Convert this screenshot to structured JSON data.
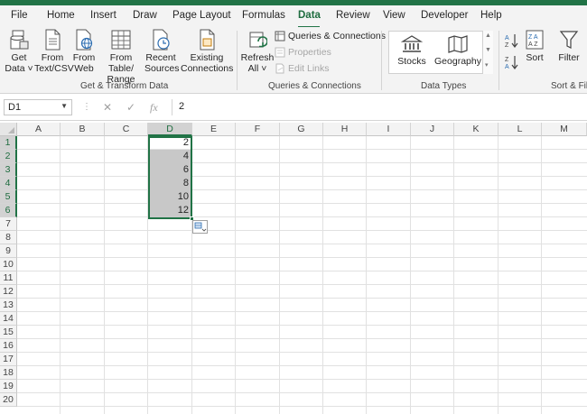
{
  "menu": {
    "tabs": [
      "File",
      "Home",
      "Insert",
      "Draw",
      "Page Layout",
      "Formulas",
      "Data",
      "Review",
      "View",
      "Developer",
      "Help"
    ],
    "active_tab": "Data"
  },
  "ribbon": {
    "get_data": {
      "line1": "Get",
      "line2": "Data ˅"
    },
    "from_text_csv": {
      "line1": "From",
      "line2": "Text/CSV"
    },
    "from_web": {
      "line1": "From",
      "line2": "Web"
    },
    "from_table_range": {
      "line1": "From Table/",
      "line2": "Range"
    },
    "recent_sources": {
      "line1": "Recent",
      "line2": "Sources"
    },
    "existing_connections": {
      "line1": "Existing",
      "line2": "Connections"
    },
    "refresh_all": {
      "line1": "Refresh",
      "line2": "All ˅"
    },
    "queries_connections": "Queries & Connections",
    "properties": "Properties",
    "edit_links": "Edit Links",
    "stocks": "Stocks",
    "geography": "Geography",
    "sort": "Sort",
    "filter": "Filter",
    "groups": {
      "get_transform": "Get & Transform Data",
      "queries": "Queries & Connections",
      "data_types": "Data Types",
      "sort_filter": "Sort & Filt"
    }
  },
  "formula_bar": {
    "name_box": "D1",
    "fx_symbol": "fx",
    "cancel_symbol": "✕",
    "enter_symbol": "✓",
    "value": "2"
  },
  "grid": {
    "columns": [
      "A",
      "B",
      "C",
      "D",
      "E",
      "F",
      "G",
      "H",
      "I",
      "J",
      "K",
      "L",
      "M"
    ],
    "rows": [
      "1",
      "2",
      "3",
      "4",
      "5",
      "6",
      "7",
      "8",
      "9",
      "10",
      "11",
      "12",
      "13",
      "14",
      "15",
      "16",
      "17",
      "18",
      "19",
      "20"
    ],
    "selected_column": "D",
    "column_d_values": [
      "2",
      "4",
      "6",
      "8",
      "10",
      "12"
    ]
  },
  "colors": {
    "accent": "#217346",
    "selection_fill": "#c8c8c8"
  }
}
